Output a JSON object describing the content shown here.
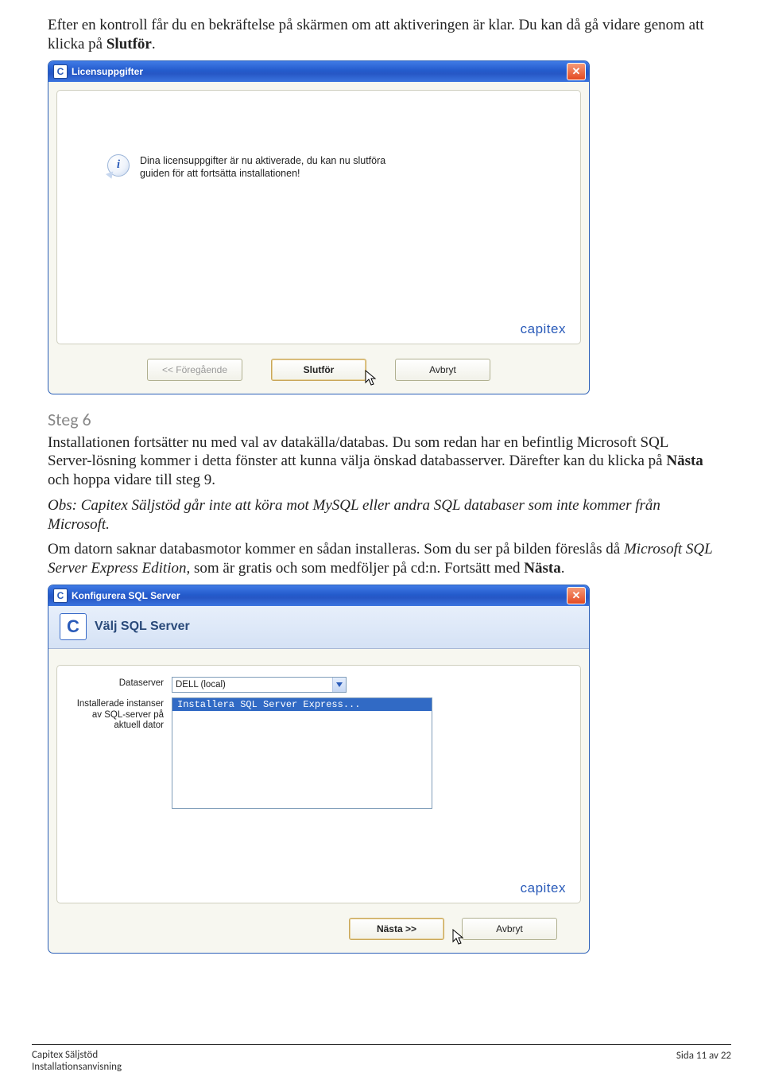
{
  "intro": {
    "p1a": "Efter en kontroll får du en bekräftelse på skärmen om att aktiveringen är klar. Du kan då gå vidare genom att klicka på ",
    "p1b": "Slutför",
    "p1c": "."
  },
  "dialog1": {
    "title": "Licensuppgifter",
    "info_line1": "Dina licensuppgifter är nu aktiverade, du kan nu slutföra",
    "info_line2": "guiden för att fortsätta installationen!",
    "brand": "capitex",
    "btn_prev": "<< Föregående",
    "btn_finish": "Slutför",
    "btn_cancel": "Avbryt"
  },
  "section": {
    "heading": "Steg 6",
    "p2a": "Installationen fortsätter nu med val av datakälla/databas. Du som redan har en befintlig Microsoft SQL Server-lösning kommer i detta fönster att kunna välja önskad databasserver. Därefter kan du klicka på ",
    "p2b": "Nästa",
    "p2c": " och hoppa vidare till steg 9.",
    "p3": "Obs: Capitex Säljstöd går inte att köra mot MySQL eller andra SQL databaser som inte kommer från Microsoft.",
    "p4a": "Om datorn saknar databasmotor kommer en sådan installeras. Som du ser på bilden föreslås då ",
    "p4b": "Microsoft SQL Server Express Edition",
    "p4c": ", som är gratis och som medföljer på cd:n. Fortsätt med ",
    "p4d": "Nästa",
    "p4e": "."
  },
  "dialog2": {
    "title": "Konfigurera SQL Server",
    "header": "Välj SQL Server",
    "label_dataserver": "Dataserver",
    "combo_value": "DELL (local)",
    "label_instances_l1": "Installerade instanser",
    "label_instances_l2": "av SQL-server på",
    "label_instances_l3": "aktuell dator",
    "list_selected": "Installera SQL Server Express...",
    "brand": "capitex",
    "btn_next": "Nästa >>",
    "btn_cancel": "Avbryt"
  },
  "footer": {
    "product": "Capitex Säljstöd",
    "subtitle": "Installationsanvisning",
    "page": "Sida 11 av 22"
  }
}
